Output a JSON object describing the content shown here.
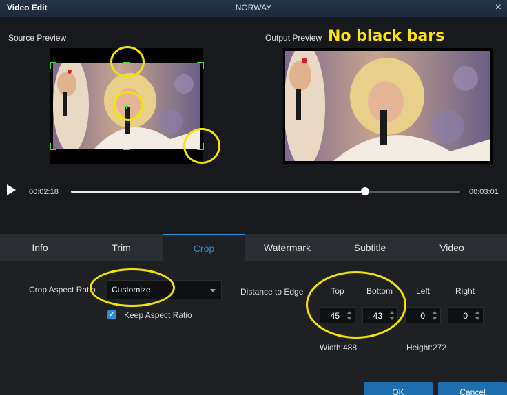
{
  "window": {
    "app_title": "Video Edit",
    "file_name": "NORWAY",
    "close_glyph": "×"
  },
  "preview": {
    "source_label": "Source Preview",
    "output_label": "Output Preview",
    "annotation": "No black bars",
    "crosshair_glyph": "+"
  },
  "playback": {
    "current_time": "00:02:18",
    "total_time": "00:03:01",
    "progress": 0.755
  },
  "tabs": [
    {
      "label": "Info"
    },
    {
      "label": "Trim"
    },
    {
      "label": "Crop"
    },
    {
      "label": "Watermark"
    },
    {
      "label": "Subtitle"
    },
    {
      "label": "Video"
    }
  ],
  "crop": {
    "aspect_label": "Crop Aspect Ratio",
    "aspect_value": "Customize",
    "keep_aspect_label": "Keep Aspect Ratio",
    "keep_aspect_checked": true,
    "check_glyph": "✓",
    "distance_label": "Distance to Edge",
    "top_label": "Top",
    "bottom_label": "Bottom",
    "left_label": "Left",
    "right_label": "Right",
    "top_value": "45",
    "bottom_value": "43",
    "left_value": "0",
    "right_value": "0",
    "width_text": "Width:488",
    "height_text": "Height:272"
  },
  "buttons": {
    "ok": "OK",
    "cancel": "Cancel"
  },
  "colors": {
    "accent": "#2b8fd6",
    "crop_handle": "#2ee63a",
    "annotation": "#ffe600"
  }
}
